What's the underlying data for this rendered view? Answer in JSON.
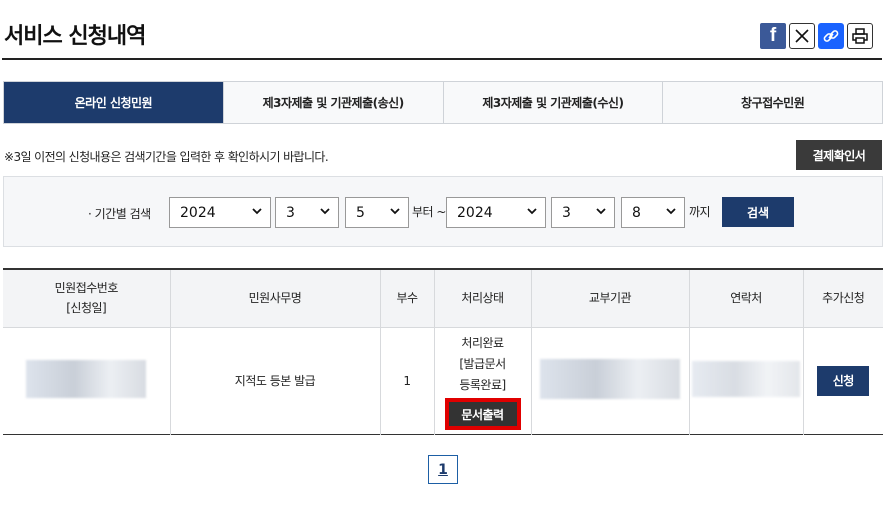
{
  "page": {
    "title": "서비스 신청내역"
  },
  "share": [
    {
      "name": "facebook-icon",
      "glyph": "f"
    },
    {
      "name": "x-icon",
      "glyph": ""
    },
    {
      "name": "link-icon",
      "glyph": ""
    },
    {
      "name": "print-icon",
      "glyph": ""
    }
  ],
  "tabs": [
    {
      "label": "온라인 신청민원",
      "active": true
    },
    {
      "label": "제3자제출 및 기관제출(송신)",
      "active": false
    },
    {
      "label": "제3자제출 및 기관제출(수신)",
      "active": false
    },
    {
      "label": "창구접수민원",
      "active": false
    }
  ],
  "notice": "※3일 이전의 신청내용은 검색기간을 입력한 후 확인하시기 바랍니다.",
  "confirm_button": "결제확인서",
  "search": {
    "label": "· 기간별 검색",
    "from_year": "2024",
    "from_month": "3",
    "from_day": "5",
    "from_word": "부터 ~",
    "to_year": "2024",
    "to_month": "3",
    "to_day": "8",
    "to_word": "까지",
    "button": "검색"
  },
  "table": {
    "headers": {
      "receipt_no": "민원접수번호",
      "receipt_date": "[신청일]",
      "name": "민원사무명",
      "copies": "부수",
      "status": "처리상태",
      "agency": "교부기관",
      "contact": "연락처",
      "extra": "추가신청"
    },
    "rows": [
      {
        "name": "지적도 등본 발급",
        "copies": "1",
        "status_line1": "처리완료",
        "status_line2": "[발급문서",
        "status_line3": "등록완료]",
        "print_button": "문서출력",
        "apply_button": "신청"
      }
    ]
  },
  "pagination": {
    "current": "1"
  },
  "colors": {
    "navy": "#1d3b6c",
    "highlight": "#e00000",
    "dark_button": "#3a3a3a"
  }
}
